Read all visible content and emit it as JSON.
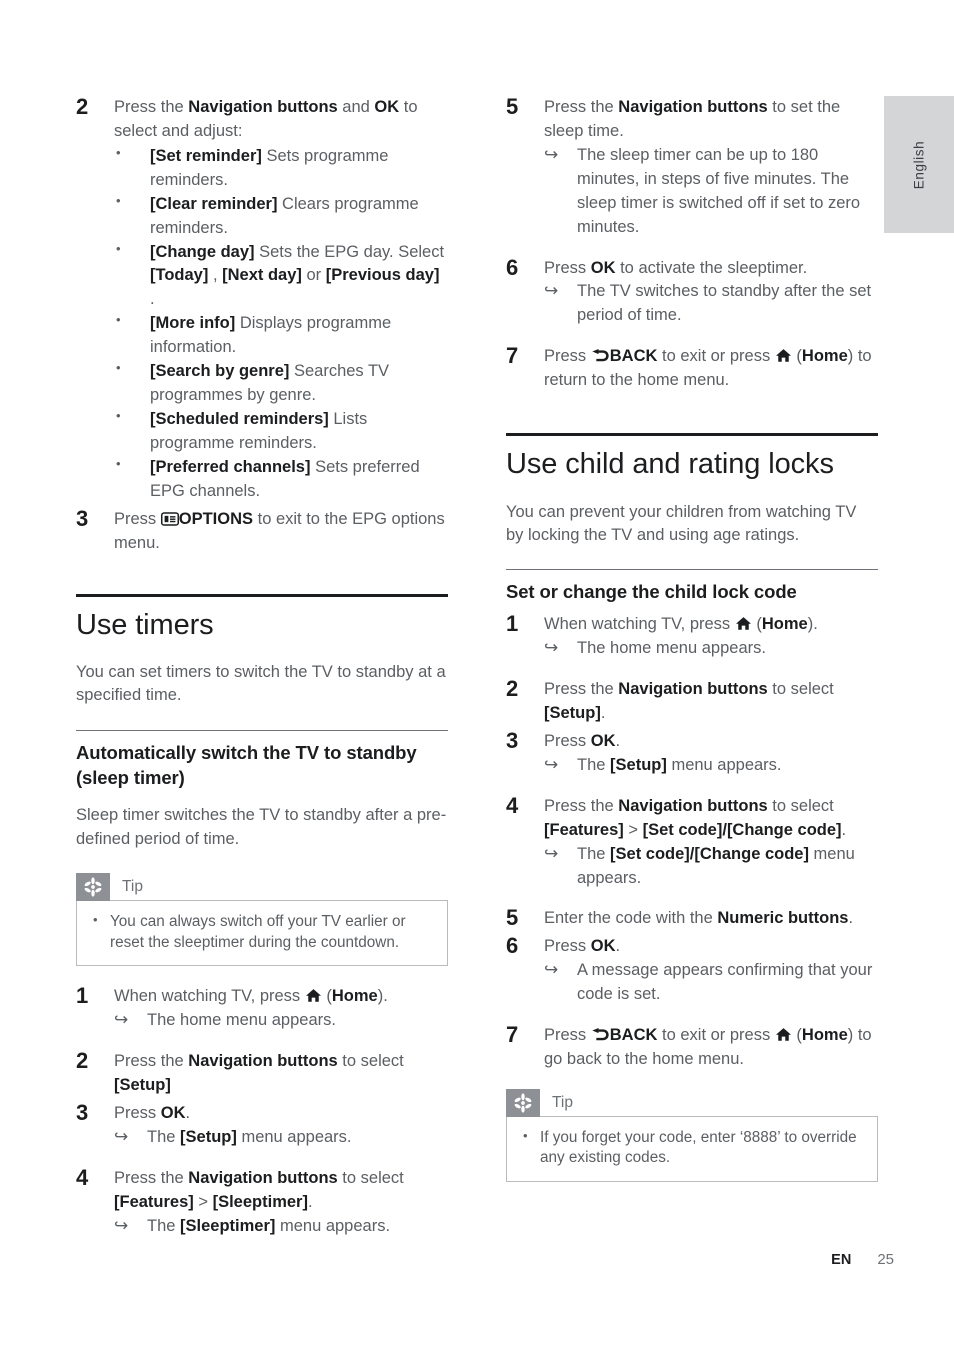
{
  "page": {
    "language_tab": "English",
    "footer_left": "EN",
    "footer_page_number": "25"
  },
  "left_column": {
    "step2": {
      "num": "2",
      "lead_a": "Press the ",
      "lead_b": "Navigation buttons",
      "lead_c": " and ",
      "lead_d": "OK",
      "lead_e": " to select and adjust:",
      "bullets": [
        {
          "term": "[Set reminder]",
          "desc": " Sets programme reminders."
        },
        {
          "term": "[Clear reminder]",
          "desc": " Clears programme reminders."
        },
        {
          "term": "[Change day]",
          "desc": " Sets the EPG day. Select ",
          "term2": "[Today]",
          "desc2": " , ",
          "term3": "[Next day]",
          "desc3": "  or ",
          "term4": "[Previous day]",
          "desc4": " ."
        },
        {
          "term": "[More info]",
          "desc": " Displays programme information."
        },
        {
          "term": "[Search by genre]",
          "desc": " Searches TV programmes by genre."
        },
        {
          "term": "[Scheduled reminders]",
          "desc": " Lists programme reminders."
        },
        {
          "term": "[Preferred channels]",
          "desc": " Sets preferred EPG channels."
        }
      ]
    },
    "step3": {
      "num": "3",
      "text_a": "Press ",
      "icon": "options-icon",
      "text_b": "OPTIONS",
      "text_c": " to exit to the EPG options menu."
    },
    "section_timers": {
      "title": "Use timers",
      "intro": "You can set timers to switch the TV to standby at a specified time."
    },
    "subsection_sleep": {
      "title": "Automatically switch the TV to standby (sleep timer)",
      "intro": "Sleep timer switches the TV to standby after a pre-defined period of time."
    },
    "tip": {
      "label": "Tip",
      "icon": "tip-asterisk-icon",
      "items": [
        "You can always switch off your TV earlier or reset the sleeptimer during the countdown."
      ]
    },
    "steps": [
      {
        "num": "1",
        "text_a": "When watching TV, press ",
        "icon": "home-icon",
        "text_b": " (",
        "bold": "Home",
        "text_c": ").",
        "result": "The home menu appears."
      },
      {
        "num": "2",
        "text_a": "Press the ",
        "bold": "Navigation buttons",
        "text_b": " to select ",
        "bold2": "[Setup]",
        "text_c": ""
      },
      {
        "num": "3",
        "text_a": "Press ",
        "bold": "OK",
        "text_b": ".",
        "result_a": "The ",
        "result_bold": "[Setup]",
        "result_b": " menu appears."
      },
      {
        "num": "4",
        "text_a": "Press the ",
        "bold": "Navigation buttons",
        "text_b": " to select ",
        "bold2": "[Features]",
        "text_c": " > ",
        "bold3": "[Sleeptimer]",
        "text_d": ".",
        "result_a": "The ",
        "result_bold": "[Sleeptimer]",
        "result_b": " menu appears."
      }
    ]
  },
  "right_column": {
    "step5": {
      "num": "5",
      "text_a": "Press the ",
      "bold": "Navigation buttons",
      "text_b": " to set the sleep time.",
      "result": "The sleep timer can be up to 180 minutes, in steps of five minutes. The sleep timer is switched off if set to zero minutes."
    },
    "step6": {
      "num": "6",
      "text_a": "Press ",
      "bold": "OK",
      "text_b": " to activate the sleeptimer.",
      "result": "The TV switches to standby after the set period of time."
    },
    "step7": {
      "num": "7",
      "text_a": "Press ",
      "back_icon": "back-icon",
      "bold": "BACK",
      "text_b": " to exit or press ",
      "home_icon": "home-icon",
      "text_c": " (",
      "bold2": "Home",
      "text_d": ") to return to the home menu."
    },
    "section_locks": {
      "title": "Use child and rating locks",
      "intro": "You can prevent your children from watching TV by locking the TV and using age ratings."
    },
    "subsection_childlock": {
      "title": "Set or change the child lock code"
    },
    "steps": [
      {
        "num": "1",
        "text_a": "When watching TV, press ",
        "icon": "home-icon",
        "text_b": " (",
        "bold": "Home",
        "text_c": ").",
        "result": "The home menu appears."
      },
      {
        "num": "2",
        "text_a": "Press the ",
        "bold": "Navigation buttons",
        "text_b": " to select ",
        "bold2": "[Setup]",
        "text_c": "."
      },
      {
        "num": "3",
        "text_a": "Press ",
        "bold": "OK",
        "text_b": ".",
        "result_a": "The ",
        "result_bold": "[Setup]",
        "result_b": " menu appears."
      },
      {
        "num": "4",
        "text_a": "Press the ",
        "bold": "Navigation buttons",
        "text_b": " to select ",
        "bold2": "[Features]",
        "text_c": " > ",
        "bold3": "[Set code]/[Change code]",
        "text_d": ".",
        "result_a": "The ",
        "result_bold": "[Set code]/[Change code]",
        "result_b": " menu appears."
      },
      {
        "num": "5",
        "text_a": "Enter the code with the ",
        "bold": "Numeric buttons",
        "text_b": "."
      },
      {
        "num": "6",
        "text_a": "Press ",
        "bold": "OK",
        "text_b": ".",
        "result": "A message appears confirming that your code is set."
      },
      {
        "num": "7",
        "text_a": "Press ",
        "back_icon": "back-icon",
        "bold": "BACK",
        "text_b": " to exit or press ",
        "home_icon": "home-icon",
        "text_c": " (",
        "bold2": "Home",
        "text_d": ") to go back to the home menu."
      }
    ],
    "tip": {
      "label": "Tip",
      "icon": "tip-asterisk-icon",
      "items": [
        "If you forget your code, enter ‘8888’ to override any existing codes."
      ]
    }
  },
  "colors": {
    "text": "#5b5e62",
    "heading": "#1c1d1f",
    "rule_thick": "#1c1d1f",
    "rule_thin": "#6e7276",
    "tip_icon_bg": "#8d9095",
    "tip_border": "#b9bbbe",
    "lang_tab_bg": "#d4d5d7"
  }
}
